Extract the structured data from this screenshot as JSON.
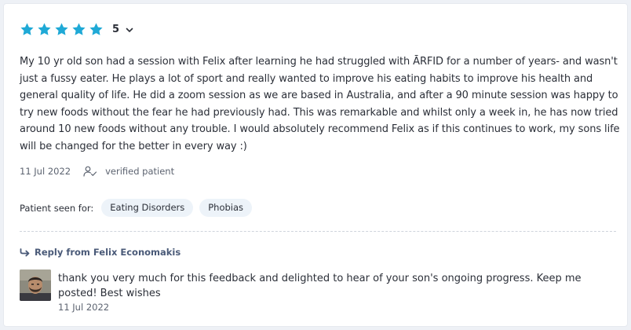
{
  "review": {
    "rating": {
      "stars": 5,
      "max_stars": 5,
      "value_label": "5",
      "star_color": "#1fa9d6"
    },
    "text": "My 10 yr old son had a session with Felix after learning he had struggled with ĀRFID for a number of years- and wasn't just a fussy eater. He plays a lot of sport and really wanted to improve his eating habits to improve his health and general quality of life. He did a zoom session as we are based in Australia, and after a 90 minute session was happy to try new foods without the fear he had previously had. This was remarkable and whilst only a week in, he has now tried around 10 new foods without any trouble. I would absolutely recommend Felix as if this continues to work, my sons life will be changed for the better in every way :)",
    "date": "11 Jul 2022",
    "verified_label": "verified patient",
    "verified_icon": "user-check-icon",
    "seen_for": {
      "label": "Patient seen for:",
      "tags": [
        "Eating Disorders",
        "Phobias"
      ]
    }
  },
  "reply": {
    "heading": "Reply from Felix Economakis",
    "heading_icon": "reply-arrow-icon",
    "heading_color": "#4a5a78",
    "text": "thank you very much for this feedback and delighted to hear of your son's ongoing progress. Keep me posted! Best wishes",
    "date": "11 Jul 2022"
  }
}
